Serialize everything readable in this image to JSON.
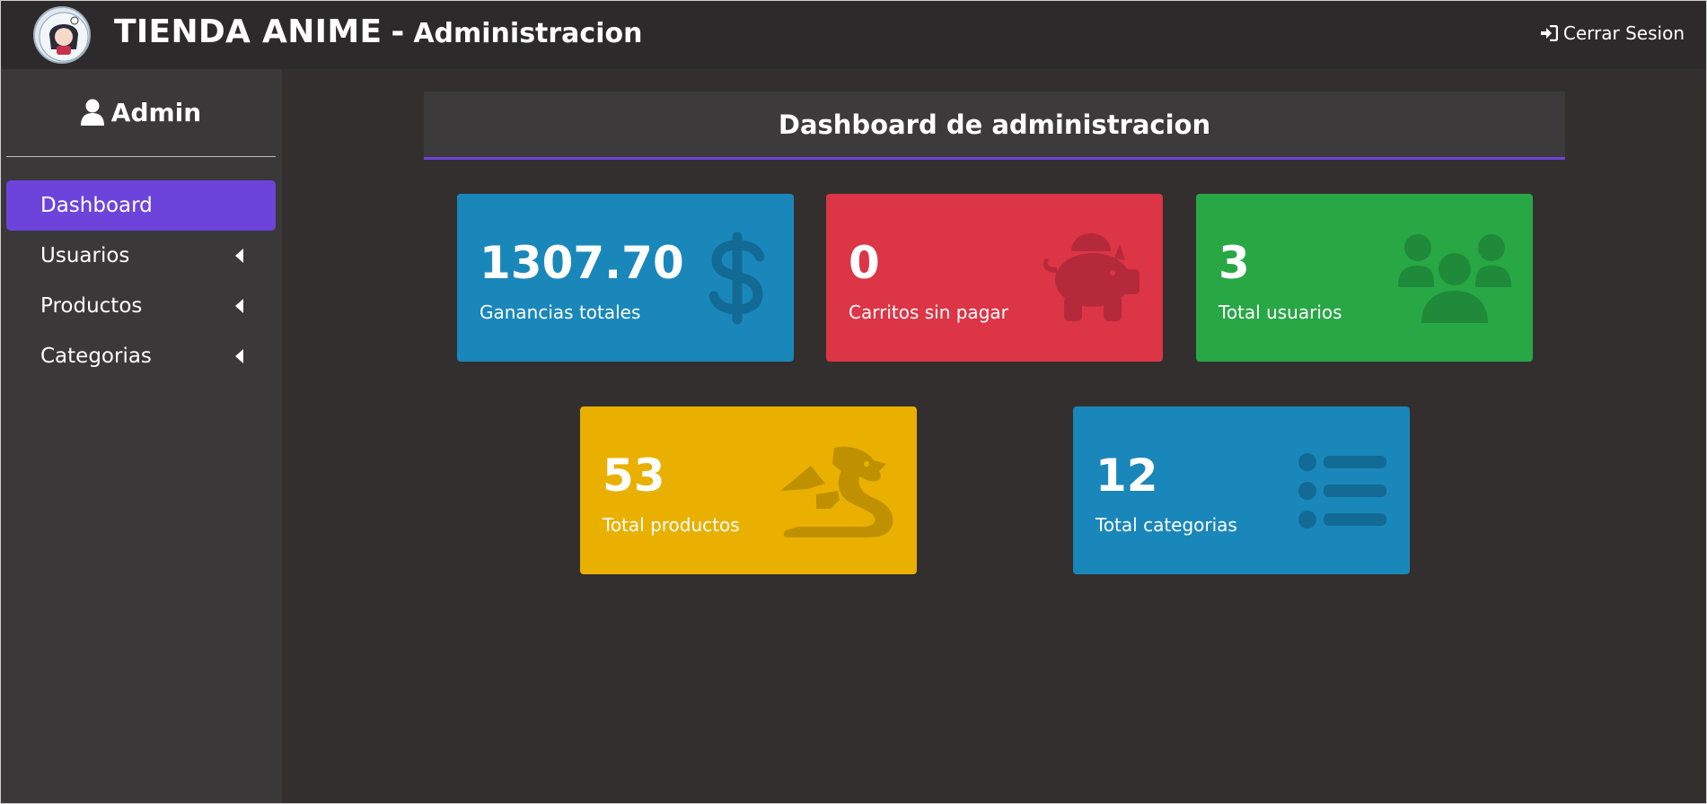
{
  "app": {
    "title": "TIENDA ANIME",
    "separator": "-",
    "subtitle": "Administracion",
    "logout_label": "Cerrar Sesion"
  },
  "sidebar": {
    "user_label": "Admin",
    "items": [
      {
        "label": "Dashboard",
        "active": true,
        "has_submenu": false
      },
      {
        "label": "Usuarios",
        "active": false,
        "has_submenu": true
      },
      {
        "label": "Productos",
        "active": false,
        "has_submenu": true
      },
      {
        "label": "Categorias",
        "active": false,
        "has_submenu": true
      }
    ]
  },
  "main": {
    "title": "Dashboard de administracion",
    "cards": [
      {
        "value": "1307.70",
        "label": "Ganancias totales",
        "icon": "dollar-icon",
        "color": "#1a87ba"
      },
      {
        "value": "0",
        "label": "Carritos sin pagar",
        "icon": "piggy-bank-icon",
        "color": "#dc3546"
      },
      {
        "value": "3",
        "label": "Total usuarios",
        "icon": "users-icon",
        "color": "#28a745"
      },
      {
        "value": "53",
        "label": "Total productos",
        "icon": "dragon-icon",
        "color": "#e9b000"
      },
      {
        "value": "12",
        "label": "Total categorias",
        "icon": "list-icon",
        "color": "#1a87ba"
      }
    ]
  },
  "colors": {
    "topbar": "#2c2a2a",
    "sidebar": "#3a3838",
    "background": "#332f2f",
    "accent": "#6c44dc"
  }
}
